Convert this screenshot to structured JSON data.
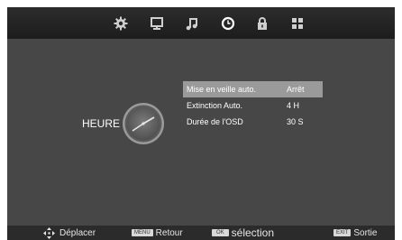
{
  "tabs": [
    {
      "icon": "gear-icon"
    },
    {
      "icon": "monitor-icon"
    },
    {
      "icon": "music-note-icon"
    },
    {
      "icon": "clock-icon"
    },
    {
      "icon": "lock-icon"
    },
    {
      "icon": "grid-icon"
    }
  ],
  "active_tab_index": 3,
  "section": {
    "label": "HEURE"
  },
  "menu": {
    "items": [
      {
        "label": "Mise en veille auto.",
        "value": "Arrêt",
        "selected": true
      },
      {
        "label": "Extinction Auto.",
        "value": "4 H",
        "selected": false
      },
      {
        "label": "Durée de l'OSD",
        "value": "30 S",
        "selected": false
      }
    ]
  },
  "bottom_bar": {
    "move": {
      "label": "Déplacer"
    },
    "back": {
      "key": "MENU",
      "label": "Retour"
    },
    "select": {
      "key": "OK",
      "label": "sélection"
    },
    "exit": {
      "key": "EXIT",
      "label": "Sortie"
    }
  },
  "colors": {
    "background": "#474747",
    "topbar": "#232323",
    "bottombar": "#2b2b2b",
    "selection": "#9a9a9a",
    "text": "#ffffff"
  }
}
